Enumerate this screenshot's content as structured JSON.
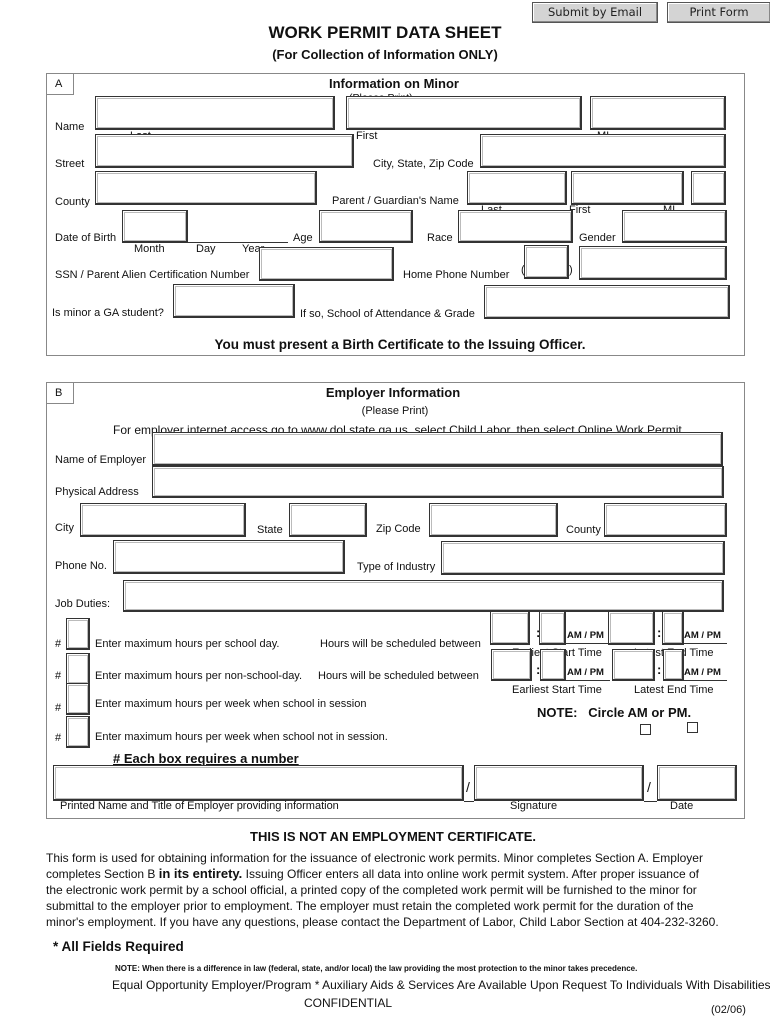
{
  "toolbar": {
    "submit_email": "Submit by Email",
    "print_form": "Print Form"
  },
  "header": {
    "title": "WORK PERMIT DATA SHEET",
    "subtitle": "(For Collection of Information ONLY)"
  },
  "section_a": {
    "letter": "A",
    "heading": "Information on Minor",
    "please_print": "(Please Print)",
    "name_label": "Name",
    "name_sub": {
      "last": "Last",
      "first": "First",
      "mi": "MI"
    },
    "street_label": "Street",
    "city_label": "City, State, Zip Code",
    "county_label": "County",
    "parent_label": "Parent / Guardian's Name",
    "parent_sub": {
      "last": "Last",
      "first": "First",
      "mi": "MI"
    },
    "dob_label": "Date of Birth",
    "dob_sub": {
      "month": "Month",
      "day": "Day",
      "year": "Year"
    },
    "age_label": "Age",
    "race_label": "Race",
    "gender_label": "Gender",
    "ssn_label": "SSN / Parent Alien Certification Number",
    "home_phone_label": "Home Phone Number",
    "paren_open": "(",
    "paren_close": ")",
    "ga_student_label": "Is minor a GA student?",
    "school_label": "If so, School of Attendance & Grade",
    "birth_cert_note": "You must present a Birth Certificate to the Issuing Officer.",
    "fields": {
      "name_last": "",
      "name_first": "",
      "name_mi": "",
      "street": "",
      "city_state_zip": "",
      "county": "",
      "parent_last": "",
      "parent_first": "",
      "parent_mi": "",
      "dob": "",
      "age": "",
      "race": "",
      "gender": "",
      "ssn": "",
      "area_code": "",
      "home_phone": "",
      "ga_student": "",
      "school_grade": ""
    }
  },
  "section_b": {
    "letter": "B",
    "heading": "Employer Information",
    "please_print": "(Please Print)",
    "internet_note": "For employer internet access go to www.dol.state.ga.us, select Child Labor, then select Online Work Permit.",
    "employer_name_label": "Name of Employer",
    "physical_address_label": "Physical Address",
    "city_label": "City",
    "state_label": "State",
    "zip_label": "Zip Code",
    "county_label": "County",
    "phone_label": "Phone No.",
    "industry_label": "Type of Industry",
    "job_duties_label": "Job Duties:",
    "hash": "#",
    "hours_rows": [
      {
        "label": "Enter maximum hours per school day.",
        "value": ""
      },
      {
        "label": "Enter maximum hours per non-school-day.",
        "value": ""
      },
      {
        "label": "Enter maximum hours per week when school in session",
        "value": ""
      },
      {
        "label": "Enter maximum hours per week when school not in session.",
        "value": ""
      }
    ],
    "schedule_label": "Hours will be scheduled between",
    "colon": ":",
    "ampm": "AM / PM",
    "earliest_start": "Earliest Start Time",
    "latest_end": "Latest End Time",
    "circle_note": "NOTE:   Circle AM or PM.",
    "each_box_note": "# Each box requires a number",
    "slash": "/",
    "printed_name_label": "Printed Name and Title of Employer providing  information",
    "signature_label": "Signature",
    "date_label": "Date",
    "fields": {
      "employer_name": "",
      "physical_address": "",
      "city": "",
      "state": "",
      "zip": "",
      "county": "",
      "phone": "",
      "industry": "",
      "job_duties": "",
      "printed_name": "",
      "signature": "",
      "date": ""
    }
  },
  "footer": {
    "not_certificate": "THIS IS NOT AN EMPLOYMENT CERTIFICATE.",
    "paragraph": {
      "line1": "This form is used for obtaining information for the issuance of electronic work permits.  Minor completes Section A.  Employer",
      "line2_a": "completes Section B ",
      "line2_bold": "in its entirety.",
      "line2_b": " Issuing Officer enters all data into online work permit system.  After proper issuance of",
      "line3": "the electronic work permit by a school official, a printed copy of the completed work permit will be furnished to the minor for",
      "line4": "submittal to the employer prior to employment.  The employer must retain the completed work permit for the duration of the",
      "line5": "minor's employment.  If you have any questions, please contact the Department of Labor, Child Labor Section at 404-232-3260."
    },
    "all_required": "* All Fields Required",
    "law_note": "NOTE: When there is a difference in law (federal, state, and/or local) the law providing the most protection to the minor takes precedence.",
    "eeo": "Equal Opportunity Employer/Program * Auxiliary Aids & Services Are Available Upon Request To Individuals With Disabilities",
    "confidential": "CONFIDENTIAL",
    "revision": "(02/06)"
  }
}
